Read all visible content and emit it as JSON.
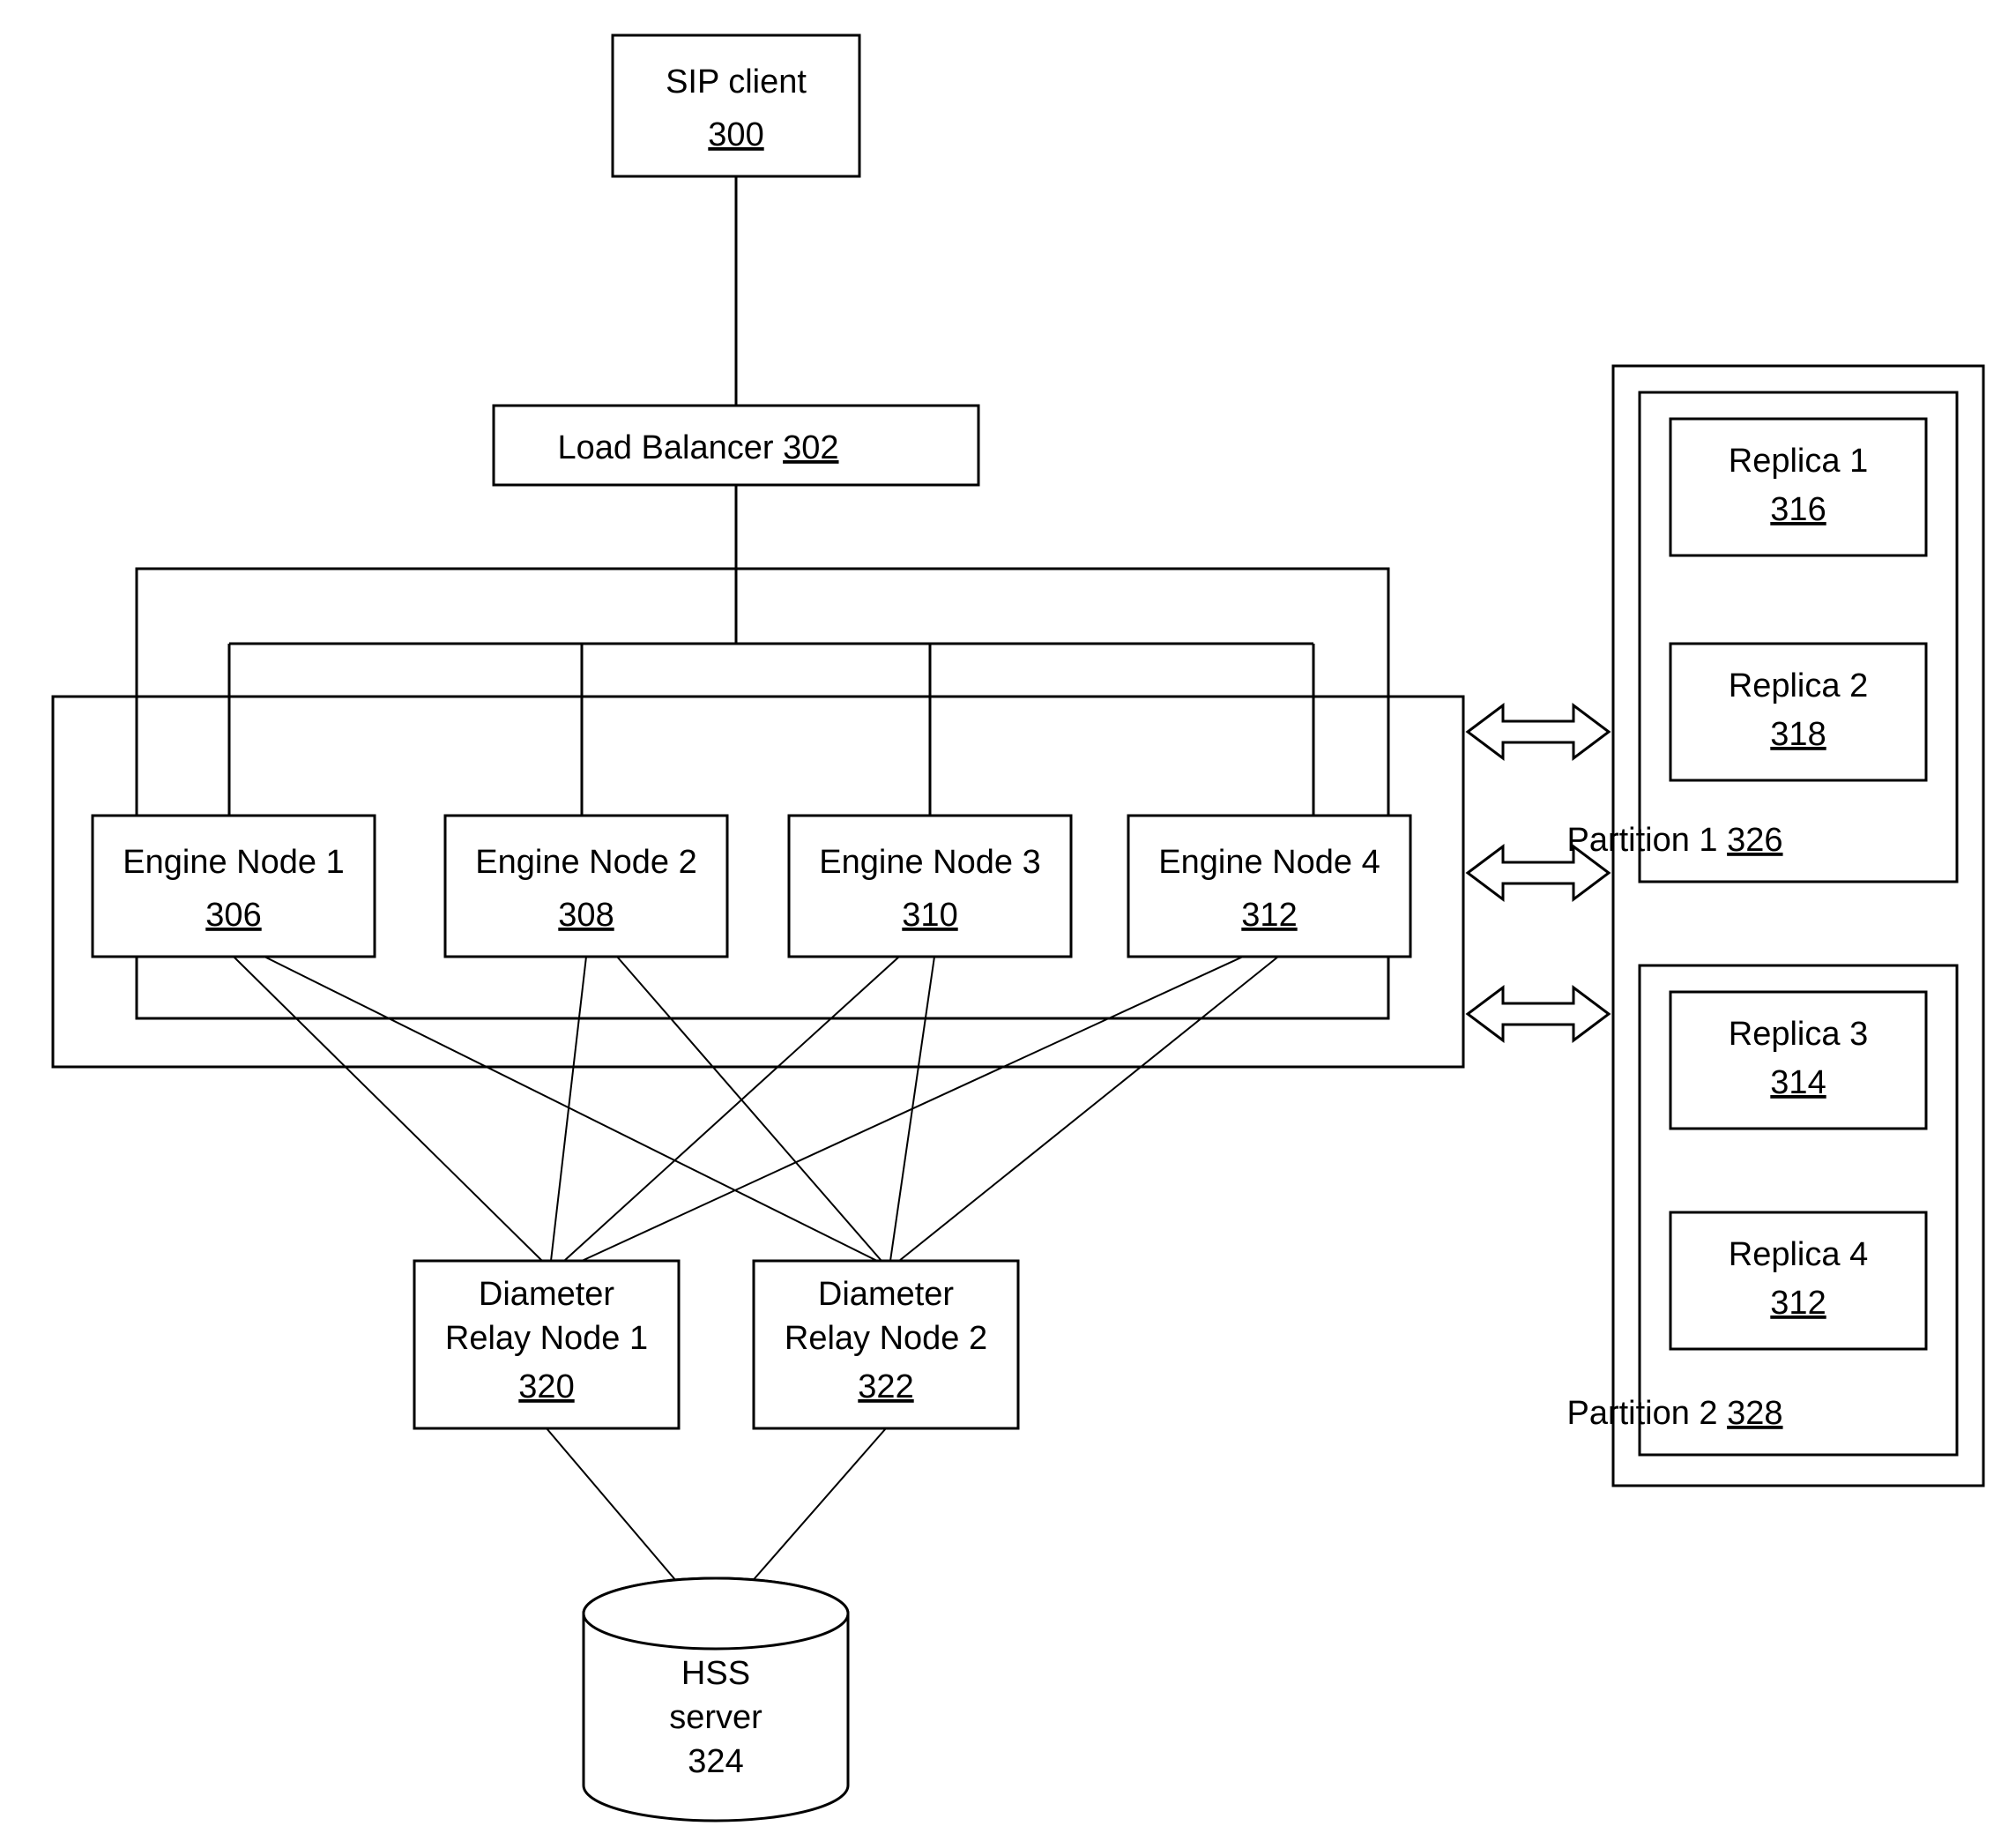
{
  "sip_client": {
    "label": "SIP client",
    "ref": "300"
  },
  "load_balancer": {
    "label": "Load Balancer",
    "ref": "302"
  },
  "engines": [
    {
      "label": "Engine Node 1",
      "ref": "306"
    },
    {
      "label": "Engine Node 2",
      "ref": "308"
    },
    {
      "label": "Engine Node 3",
      "ref": "310"
    },
    {
      "label": "Engine Node 4",
      "ref": "312"
    }
  ],
  "relays": [
    {
      "label_a": "Diameter",
      "label_b": "Relay Node 1",
      "ref": "320"
    },
    {
      "label_a": "Diameter",
      "label_b": "Relay Node 2",
      "ref": "322"
    }
  ],
  "hss": {
    "label_a": "HSS",
    "label_b": "server",
    "ref": "324"
  },
  "partitions": [
    {
      "label": "Partition 1",
      "ref": "326",
      "replicas": [
        {
          "label": "Replica 1",
          "ref": "316"
        },
        {
          "label": "Replica 2",
          "ref": "318"
        }
      ]
    },
    {
      "label": "Partition 2",
      "ref": "328",
      "replicas": [
        {
          "label": "Replica 3",
          "ref": "314"
        },
        {
          "label": "Replica 4",
          "ref": "312"
        }
      ]
    }
  ]
}
